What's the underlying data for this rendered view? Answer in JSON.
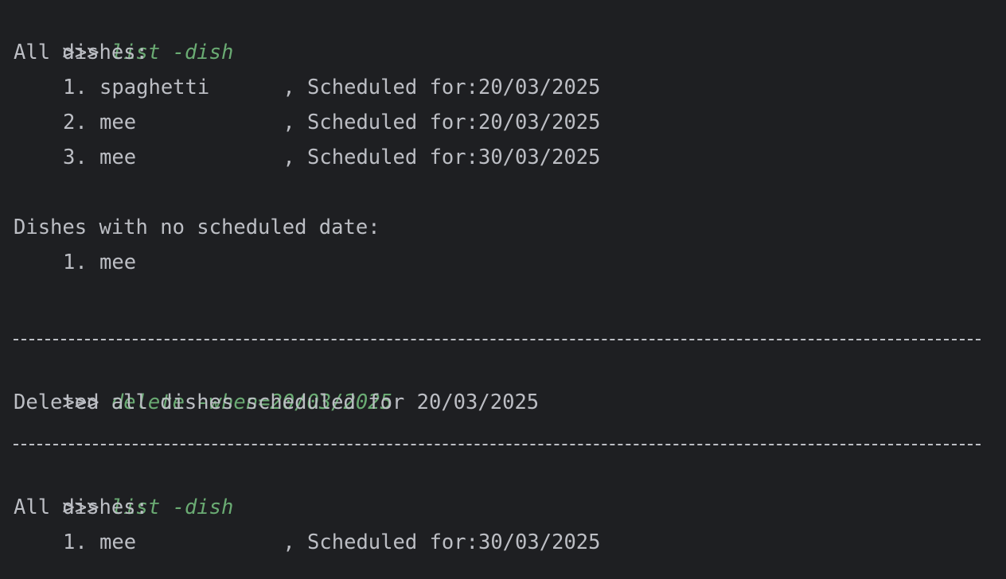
{
  "terminal": {
    "prompt": ">>>",
    "block1": {
      "command": "list -dish",
      "all_heading": "All dishes:",
      "items": [
        "1. spaghetti      , Scheduled for:20/03/2025",
        "2. mee            , Scheduled for:20/03/2025",
        "3. mee            , Scheduled for:30/03/2025"
      ],
      "unscheduled_heading": "Dishes with no scheduled date:",
      "unscheduled_items": [
        "1. mee"
      ]
    },
    "block2": {
      "command": "delete -when=20/03/2025",
      "output": "Deleted all dishes scheduled for 20/03/2025"
    },
    "block3": {
      "command": "list -dish",
      "all_heading": "All dishes:",
      "items": [
        "1. mee            , Scheduled for:30/03/2025"
      ]
    }
  }
}
